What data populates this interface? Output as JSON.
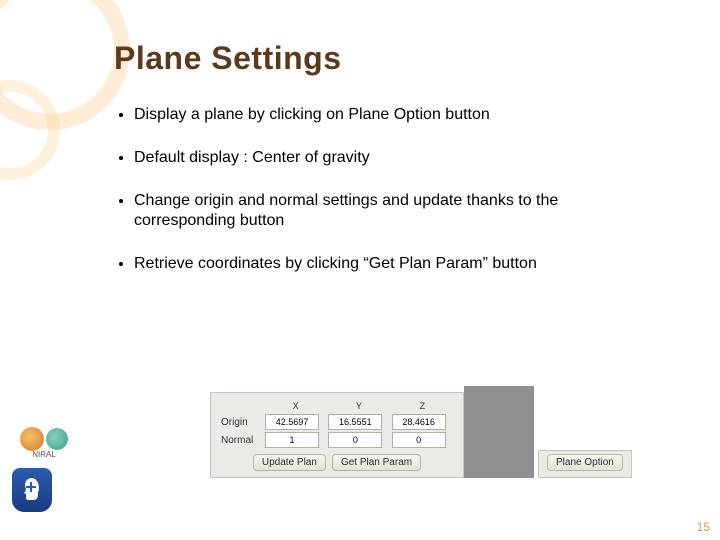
{
  "title": "Plane Settings",
  "bullets": [
    "Display a plane by clicking on Plane Option button",
    "Default display : Center of gravity",
    "Change origin and normal settings and update thanks to the corresponding button",
    "Retrieve coordinates by clicking  “Get Plan Param” button"
  ],
  "panel": {
    "headers": {
      "x": "X",
      "y": "Y",
      "z": "Z"
    },
    "rows": {
      "origin": {
        "label": "Origin",
        "x": "42.5697",
        "y": "16.5551",
        "z": "28.4616"
      },
      "normal": {
        "label": "Normal",
        "x": "1",
        "y": "0",
        "z": "0"
      }
    },
    "buttons": {
      "update": "Update Plan",
      "get": "Get Plan Param",
      "option": "Plane Option"
    }
  },
  "logos": {
    "niral": "NIRAL"
  },
  "page_number": "15"
}
